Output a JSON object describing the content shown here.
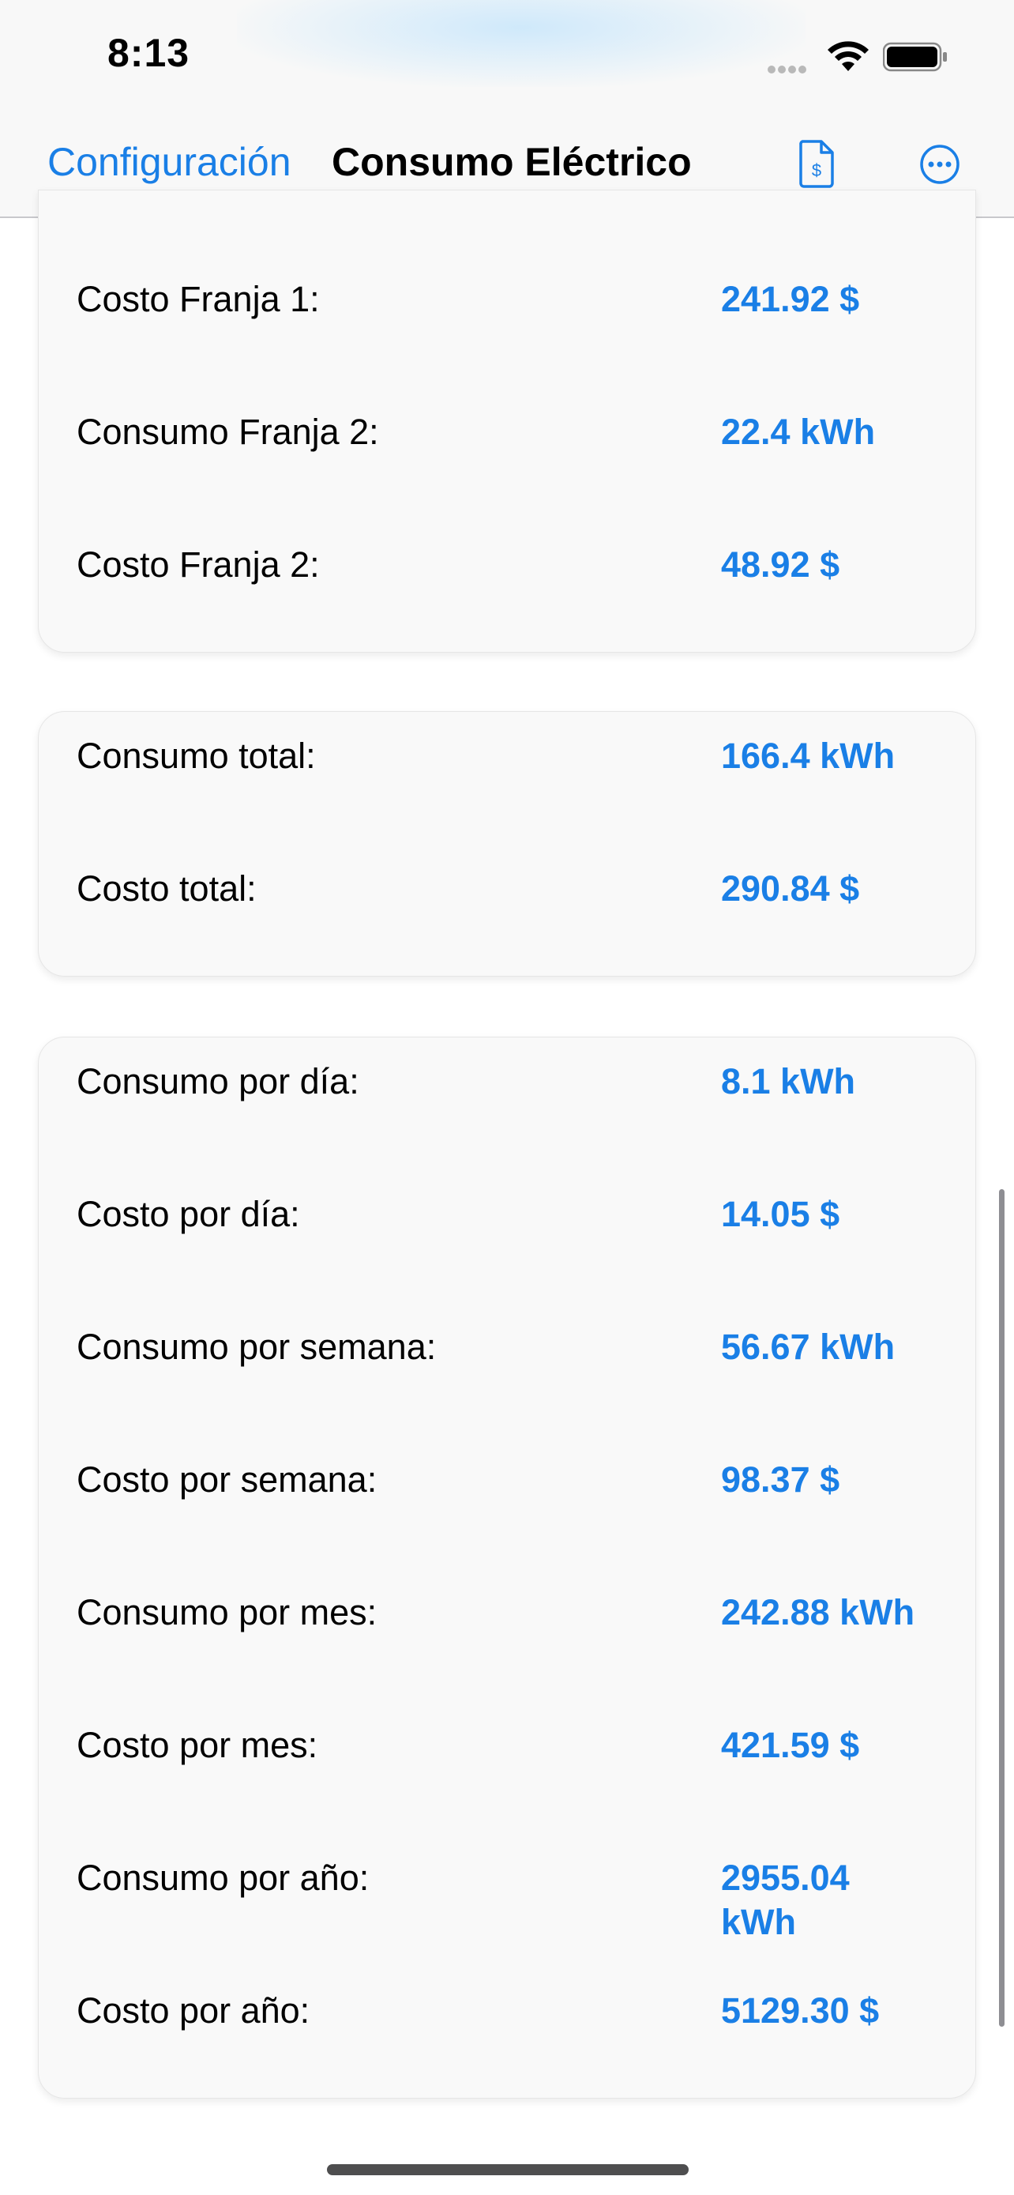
{
  "status_bar": {
    "time": "8:13"
  },
  "nav": {
    "back_label": "Configuración",
    "title": "Consumo Eléctrico",
    "icons": [
      "dollar-document-icon",
      "more-icon"
    ]
  },
  "cards": [
    {
      "rows": [
        {
          "label": "Costo Franja 1:",
          "value": "241.92 $"
        },
        {
          "label": "Consumo Franja 2:",
          "value": "22.4 kWh"
        },
        {
          "label": "Costo Franja 2:",
          "value": "48.92 $"
        }
      ]
    },
    {
      "rows": [
        {
          "label": "Consumo total:",
          "value": "166.4 kWh"
        },
        {
          "label": "Costo total:",
          "value": "290.84 $"
        }
      ]
    },
    {
      "rows": [
        {
          "label": "Consumo por día:",
          "value": "8.1 kWh"
        },
        {
          "label": "Costo por día:",
          "value": "14.05 $"
        },
        {
          "label": "Consumo por semana:",
          "value": "56.67 kWh"
        },
        {
          "label": "Costo por semana:",
          "value": "98.37 $"
        },
        {
          "label": "Consumo por mes:",
          "value": "242.88 kWh"
        },
        {
          "label": "Costo por mes:",
          "value": "421.59 $"
        },
        {
          "label": "Consumo por año:",
          "value": "2955.04 kWh"
        },
        {
          "label": "Costo por año:",
          "value": "5129.30 $"
        }
      ]
    }
  ],
  "colors": {
    "accent": "#1a7fe6",
    "card_bg": "#f9f9f9"
  }
}
